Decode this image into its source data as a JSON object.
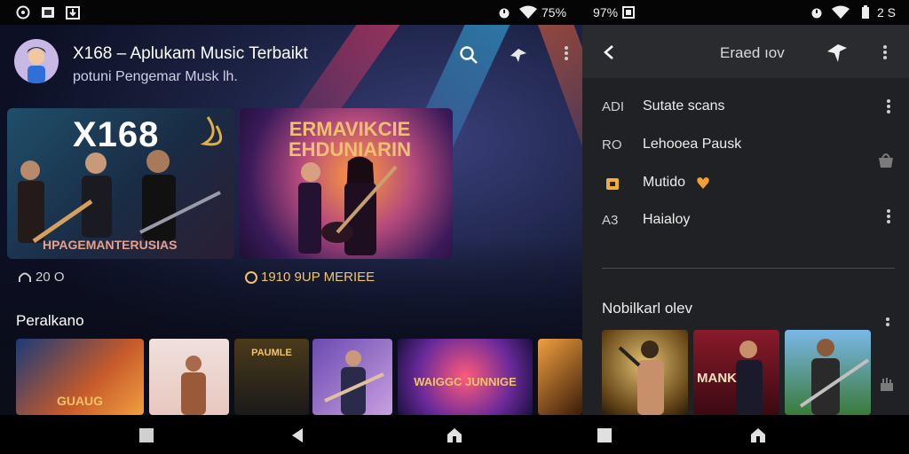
{
  "status_bar": {
    "battery_left": "75%",
    "battery_mid": "97%",
    "battery_right": "2 S",
    "icons": [
      "settings-icon",
      "gallery-icon",
      "download-icon",
      "alarm-icon",
      "wifi-icon",
      "battery-icon"
    ]
  },
  "header": {
    "title": "X168 – Aplukam Music Terbaikt",
    "subtitle": "potuni Pengemar Musk lh."
  },
  "featured": [
    {
      "title": "X168",
      "footer": "HPAGEMANTERUSIAS",
      "stat": "20 O"
    },
    {
      "title": "ERMAVIKCIE EHDUNIARIN",
      "stat": "1910 9UP MERIEE"
    }
  ],
  "section": {
    "title": "Peralkano",
    "items": [
      "GUAUG",
      "",
      "PAUMLE",
      "",
      "WAIGGC JUNNIGE",
      ""
    ]
  },
  "side_panel": {
    "title": "Eraed ıov",
    "rows": [
      {
        "num": "ADI",
        "label": "Sutate scans"
      },
      {
        "num": "RO",
        "label": "Lehooea Pausk"
      },
      {
        "num": "",
        "label": "Mutido"
      },
      {
        "num": "A3",
        "label": "Haialoy"
      }
    ],
    "section_title": "Nobilkarl olev",
    "thumbs": [
      "",
      "MANK",
      ""
    ]
  },
  "colors": {
    "accent": "#f2c468",
    "panel_bg": "#202124",
    "main_bg": "#1c2345"
  }
}
